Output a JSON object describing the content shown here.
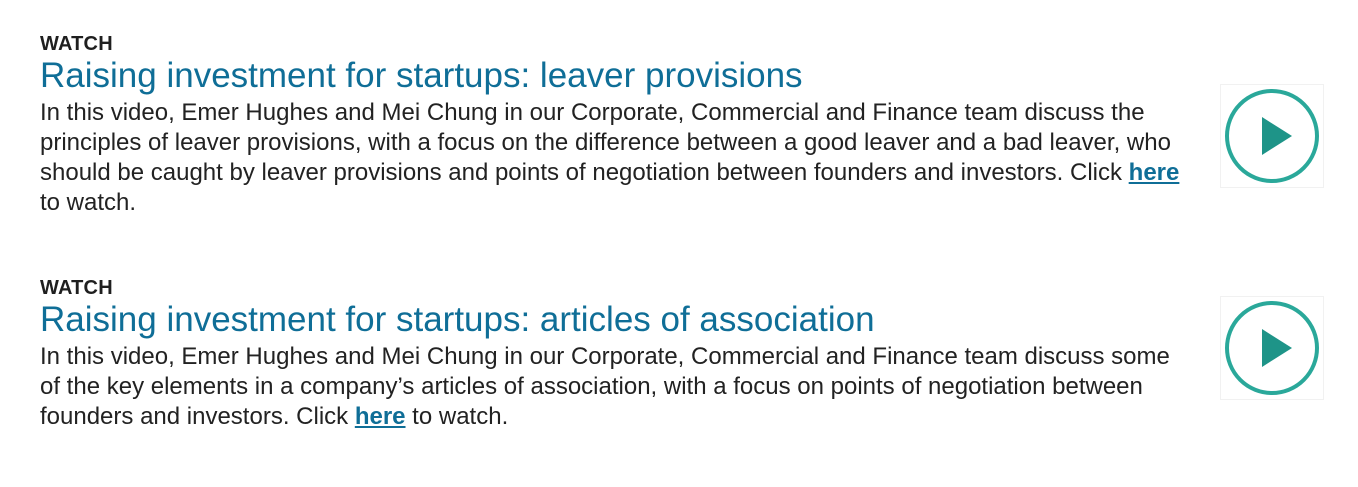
{
  "videos": [
    {
      "kicker": "WATCH",
      "title": "Raising investment for startups: leaver provisions",
      "description_before_link": "In this video, Emer Hughes and Mei Chung in our Corporate, Commercial and Finance team discuss the principles of leaver provisions, with a focus on the difference between a good leaver and a bad leaver, who should be caught by leaver provisions and points of negotiation between founders and investors. Click ",
      "link_label": "here",
      "description_after_link": " to watch.",
      "icon": "play-icon"
    },
    {
      "kicker": "WATCH",
      "title": "Raising investment for startups: articles of association",
      "description_before_link": "In this video, Emer Hughes and Mei Chung in our Corporate, Commercial and Finance team discuss some of the key elements in a company’s articles of association, with a focus on points of negotiation between founders and investors. Click ",
      "link_label": "here",
      "description_after_link": " to watch.",
      "icon": "play-icon"
    }
  ],
  "colors": {
    "accent": "#0f6e97",
    "play_ring": "#2aa89a",
    "play_triangle": "#1e9488",
    "text": "#222222"
  }
}
